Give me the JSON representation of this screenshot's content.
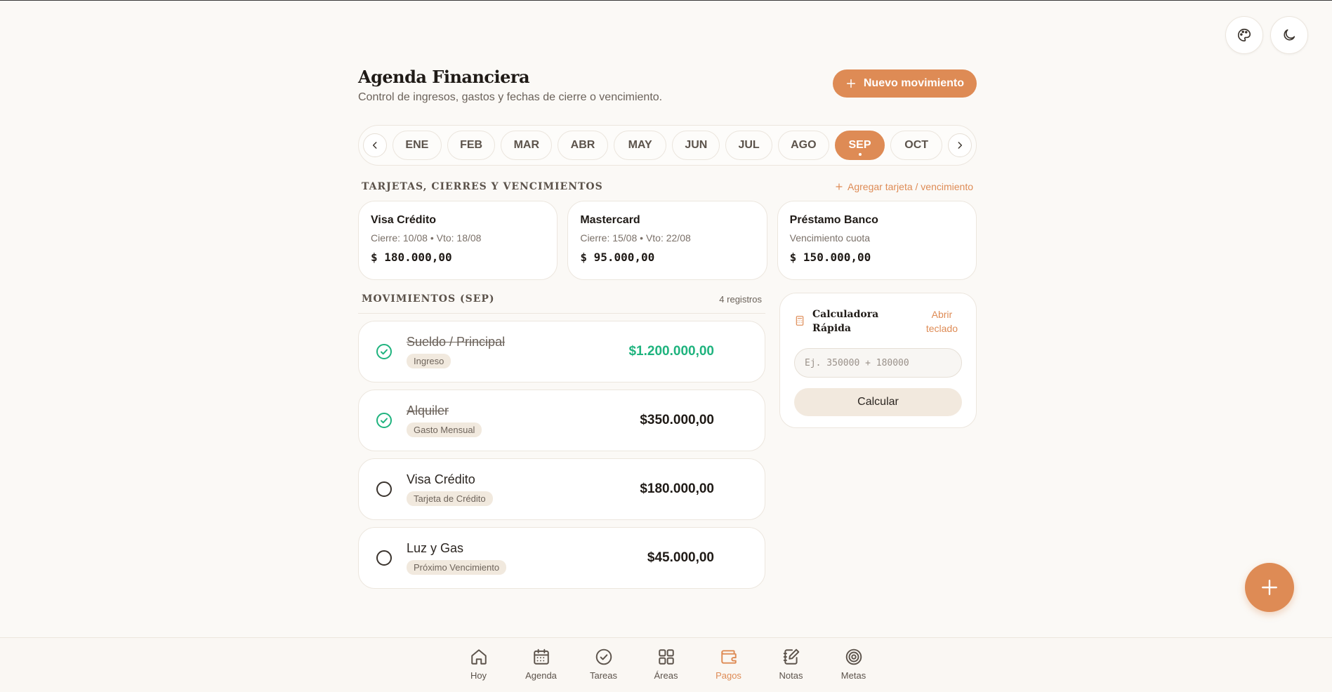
{
  "header": {
    "title": "Agenda Financiera",
    "subtitle": "Control de ingresos, gastos y fechas de cierre o vencimiento.",
    "new_button": "Nuevo movimiento"
  },
  "months": [
    "ENE",
    "FEB",
    "MAR",
    "ABR",
    "MAY",
    "JUN",
    "JUL",
    "AGO",
    "SEP",
    "OCT"
  ],
  "active_month": "SEP",
  "cards_section": {
    "title": "TARJETAS, CIERRES Y VENCIMIENTOS",
    "add_link": "Agregar tarjeta / vencimiento",
    "cards": [
      {
        "name": "Visa Crédito",
        "meta": "Cierre: 10/08 • Vto: 18/08",
        "amount": "$ 180.000,00"
      },
      {
        "name": "Mastercard",
        "meta": "Cierre: 15/08 • Vto: 22/08",
        "amount": "$ 95.000,00"
      },
      {
        "name": "Préstamo Banco",
        "meta": "Vencimiento cuota",
        "amount": "$ 150.000,00"
      }
    ]
  },
  "movements": {
    "title": "MOVIMIENTOS (SEP)",
    "count": "4 registros",
    "items": [
      {
        "title": "Sueldo / Principal",
        "tag": "Ingreso",
        "amount": "$1.200.000,00",
        "done": true,
        "income": true
      },
      {
        "title": "Alquiler",
        "tag": "Gasto Mensual",
        "amount": "$350.000,00",
        "done": true,
        "income": false
      },
      {
        "title": "Visa Crédito",
        "tag": "Tarjeta de Crédito",
        "amount": "$180.000,00",
        "done": false,
        "income": false
      },
      {
        "title": "Luz y Gas",
        "tag": "Próximo Vencimiento",
        "amount": "$45.000,00",
        "done": false,
        "income": false
      }
    ]
  },
  "calculator": {
    "title_line1": "Calculadora",
    "title_line2": "Rápida",
    "open_link_line1": "Abrir",
    "open_link_line2": "teclado",
    "placeholder": "Ej. 350000 + 180000",
    "button": "Calcular"
  },
  "nav": {
    "items": [
      {
        "label": "Hoy",
        "icon": "home-icon"
      },
      {
        "label": "Agenda",
        "icon": "calendar-icon"
      },
      {
        "label": "Tareas",
        "icon": "check-circle-icon"
      },
      {
        "label": "Áreas",
        "icon": "grid-icon"
      },
      {
        "label": "Pagos",
        "icon": "wallet-icon"
      },
      {
        "label": "Notas",
        "icon": "notes-icon"
      },
      {
        "label": "Metas",
        "icon": "target-icon"
      }
    ],
    "active": "Pagos"
  },
  "colors": {
    "accent": "#de8b55",
    "income": "#1fb37e",
    "background": "#fbf9f6"
  }
}
